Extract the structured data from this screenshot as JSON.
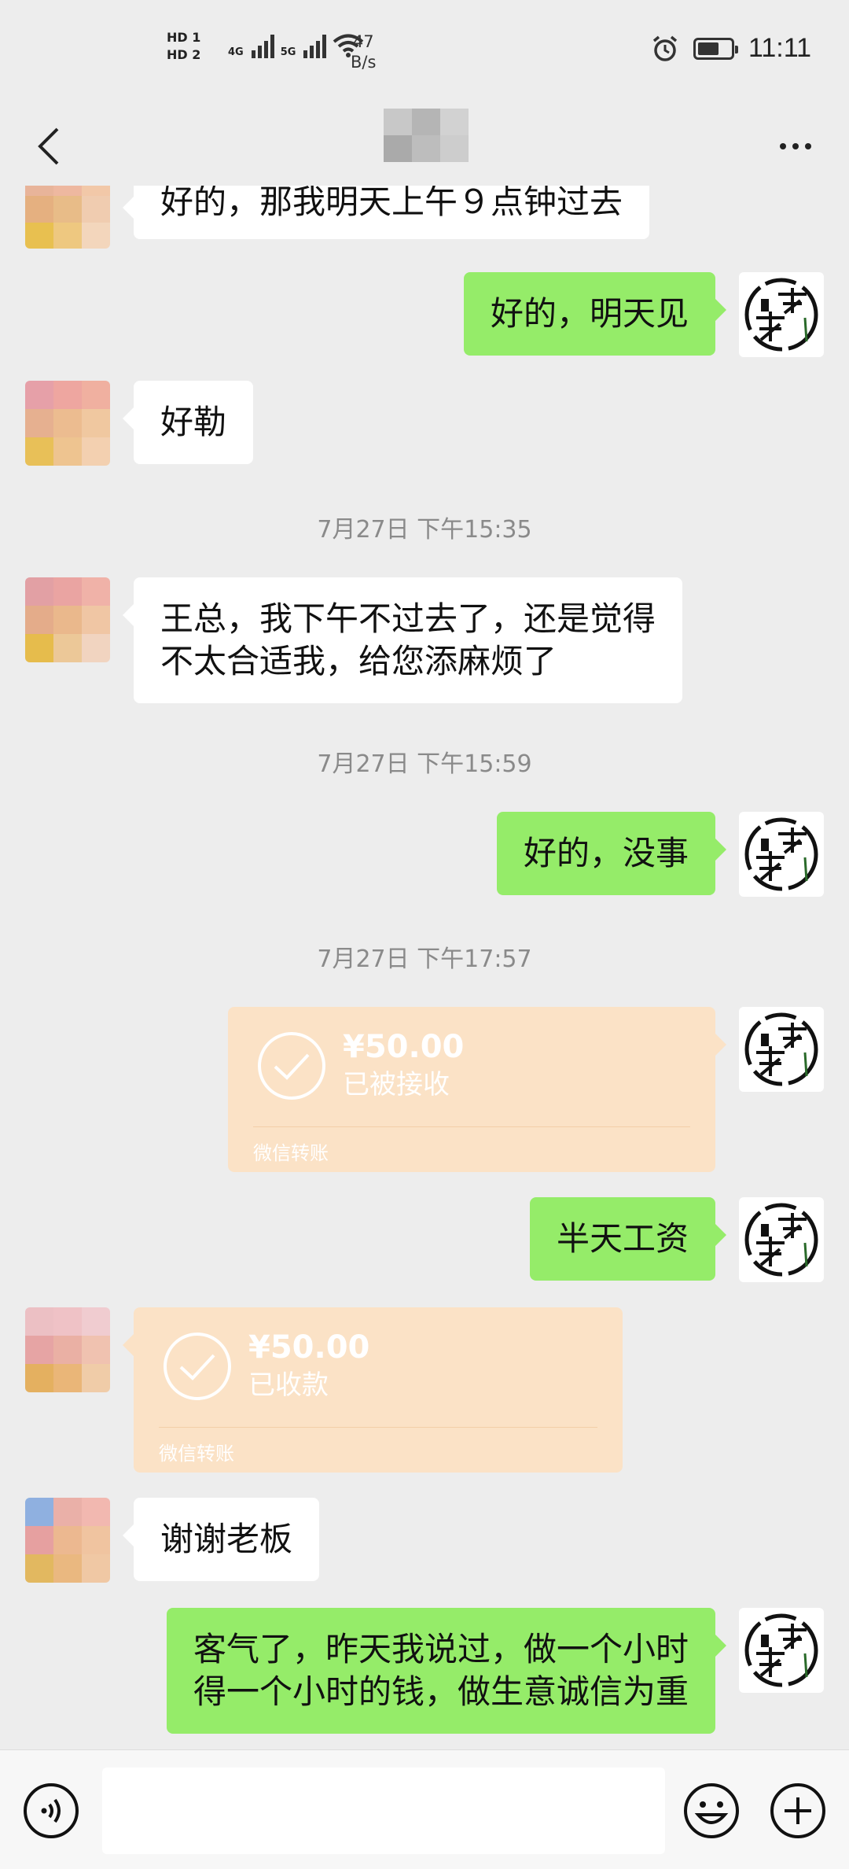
{
  "status_bar": {
    "hd1": "HD 1",
    "hd2": "HD 2",
    "net1": "4G",
    "net2": "5G",
    "speed_value": "47",
    "speed_unit": "B/s",
    "time": "11:11",
    "icons": [
      "alarm-icon",
      "battery-icon",
      "wifi-icon",
      "signal-icon"
    ]
  },
  "nav": {
    "back_icon": "chevron-left-icon",
    "more_icon": "more-dots-icon"
  },
  "messages": {
    "m1": "好的，那我明天上午９点钟过去",
    "m2": "好的，明天见",
    "m3": "好勒",
    "t1": "7月27日 下午15:35",
    "m4_line1": "王总，我下午不过去了，还是觉得",
    "m4_line2": "不太合适我，给您添麻烦了",
    "t2": "7月27日 下午15:59",
    "m5": "好的，没事",
    "t3": "7月27日 下午17:57",
    "transfer_out": {
      "amount": "¥50.00",
      "status": "已被接收",
      "footer": "微信转账"
    },
    "m6": "半天工资",
    "transfer_in": {
      "amount": "¥50.00",
      "status": "已收款",
      "footer": "微信转账"
    },
    "m7": "谢谢老板",
    "m8_line1": "客气了，昨天我说过，做一个小时",
    "m8_line2": "得一个小时的钱，做生意诚信为重"
  },
  "colors": {
    "background": "#ededed",
    "incoming_bubble": "#ffffff",
    "outgoing_bubble": "#95ec69",
    "transfer_card": "#fbe2c6",
    "timestamp_text": "#8a8a8a"
  },
  "input_bar": {
    "left_icon": "voice-icon",
    "right_icons": [
      "emoji-icon",
      "plus-icon"
    ]
  }
}
